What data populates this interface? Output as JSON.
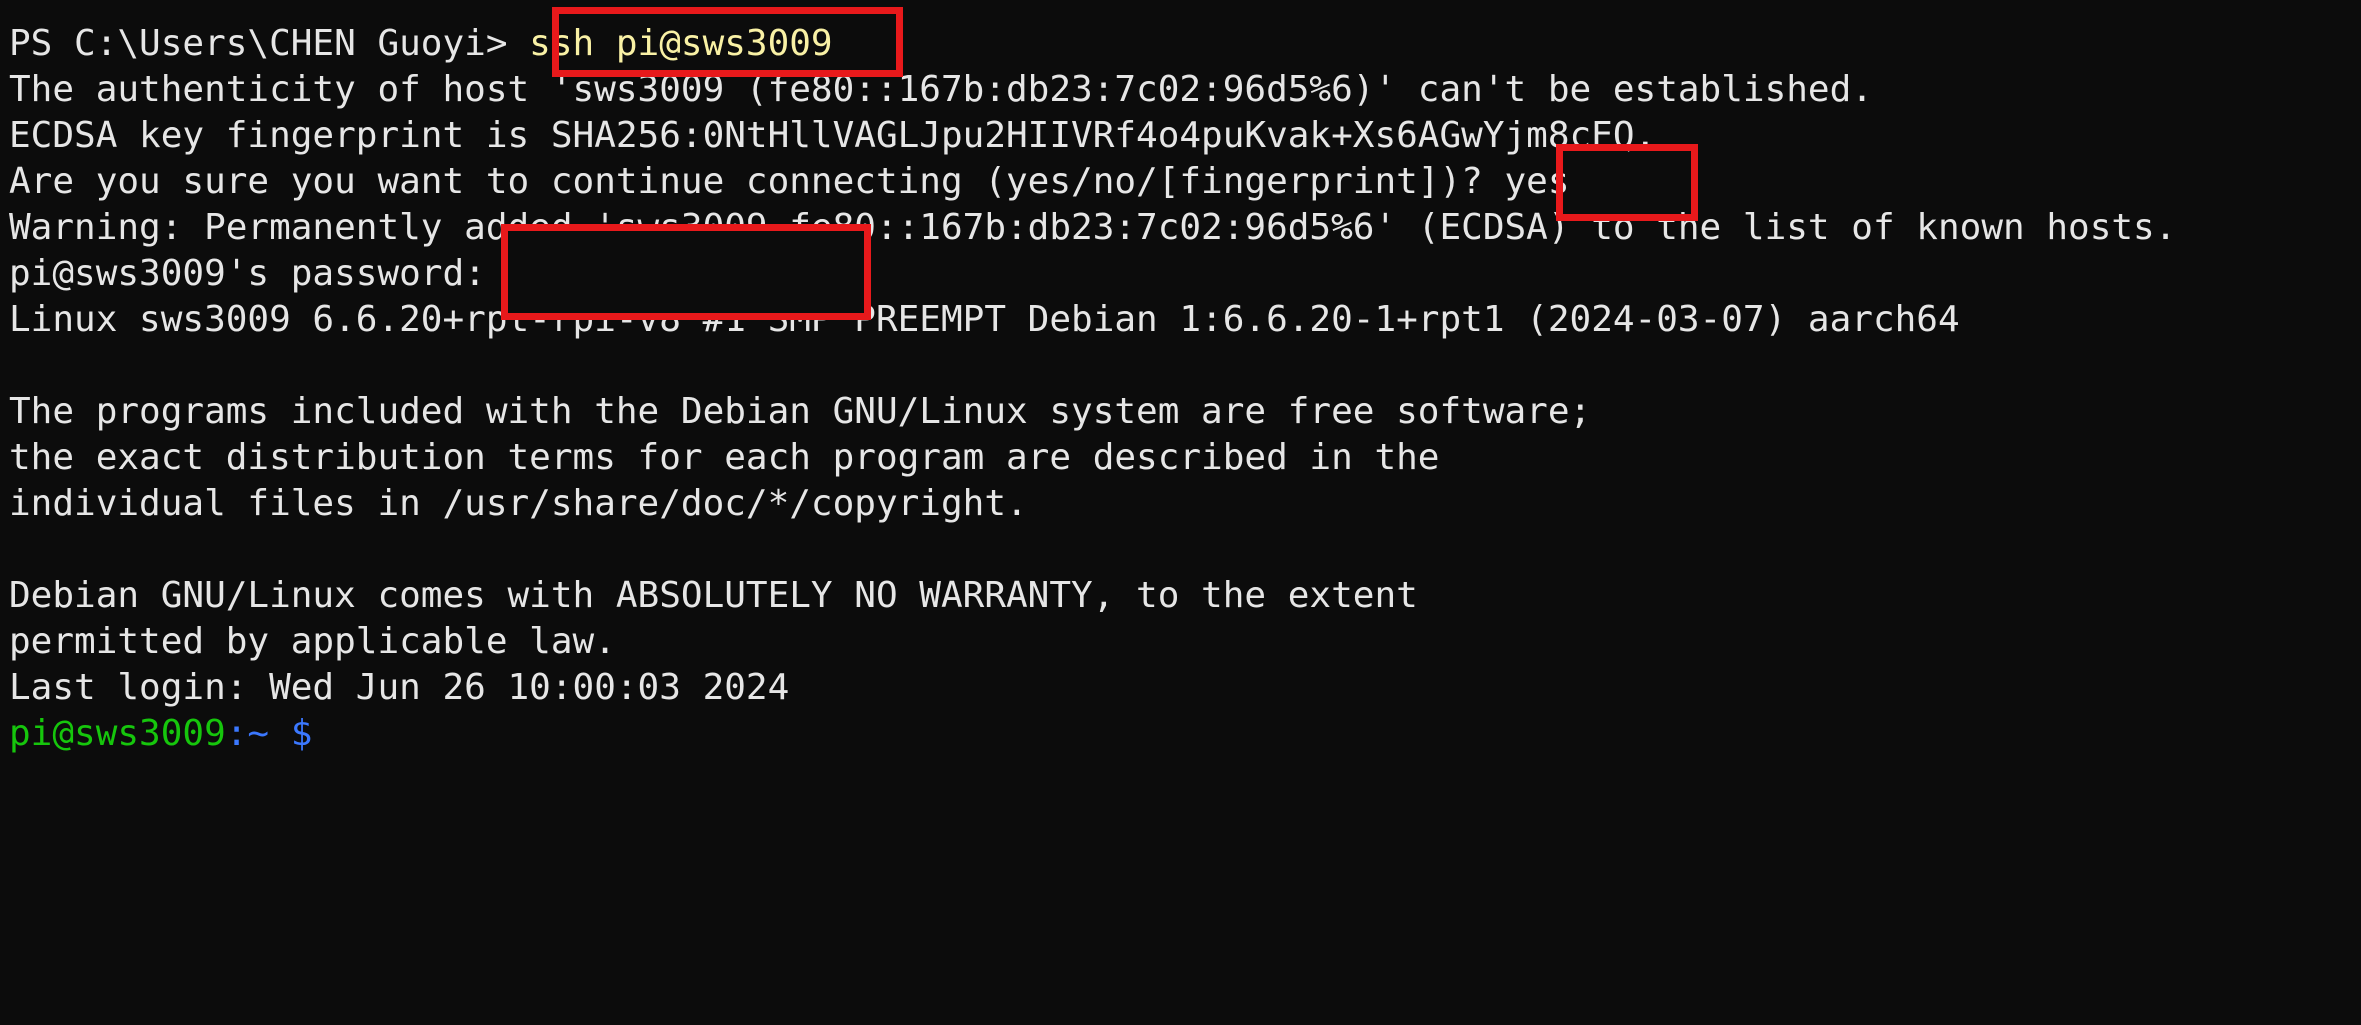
{
  "terminal": {
    "prompt_ps": "PS C:\\Users\\CHEN Guoyi> ",
    "ssh_command": "ssh pi@sws3009",
    "lines": [
      "The authenticity of host 'sws3009 (fe80::167b:db23:7c02:96d5%6)' can't be established.",
      "ECDSA key fingerprint is SHA256:0NtHllVAGLJpu2HIIVRf4o4puKvak+Xs6AGwYjm8cEQ.",
      "Are you sure you want to continue connecting (yes/no/[fingerprint])? ",
      "Warning: Permanently added 'sws3009,fe80::167b:db23:7c02:96d5%6' (ECDSA) to the list of known hosts.",
      "pi@sws3009's password:",
      "Linux sws3009 6.6.20+rpt-rpi-v8 #1 SMP PREEMPT Debian 1:6.6.20-1+rpt1 (2024-03-07) aarch64",
      "",
      "The programs included with the Debian GNU/Linux system are free software;",
      "the exact distribution terms for each program are described in the",
      "individual files in /usr/share/doc/*/copyright.",
      "",
      "Debian GNU/Linux comes with ABSOLUTELY NO WARRANTY, to the extent",
      "permitted by applicable law.",
      "Last login: Wed Jun 26 10:00:03 2024"
    ],
    "yes_answer": "yes",
    "final_prompt": {
      "user_host": "pi@sws3009",
      "path": ":~",
      "symbol": " $"
    }
  },
  "colors": {
    "background": "#0c0c0c",
    "text": "#e6e6e6",
    "command": "#f9f1a5",
    "prompt_user": "#16c60c",
    "prompt_path": "#3b78ff",
    "annotation_box": "#e8191b"
  }
}
